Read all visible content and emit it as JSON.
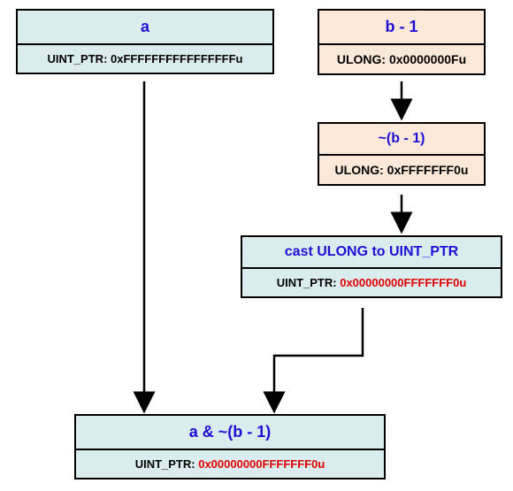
{
  "nodes": {
    "a": {
      "title": "a",
      "type": "UINT_PTR",
      "value": "0xFFFFFFFFFFFFFFFFu"
    },
    "bminus1": {
      "title": "b - 1",
      "type": "ULONG",
      "value": "0x0000000Fu"
    },
    "notbminus1": {
      "title": "~(b - 1)",
      "type": "ULONG",
      "value": "0xFFFFFFF0u"
    },
    "cast": {
      "title": "cast ULONG to UINT_PTR",
      "type": "UINT_PTR",
      "value": "0x00000000FFFFFFF0u"
    },
    "result": {
      "title": "a & ~(b - 1)",
      "type": "UINT_PTR",
      "value": "0x00000000FFFFFFF0u"
    }
  },
  "sep": ": "
}
